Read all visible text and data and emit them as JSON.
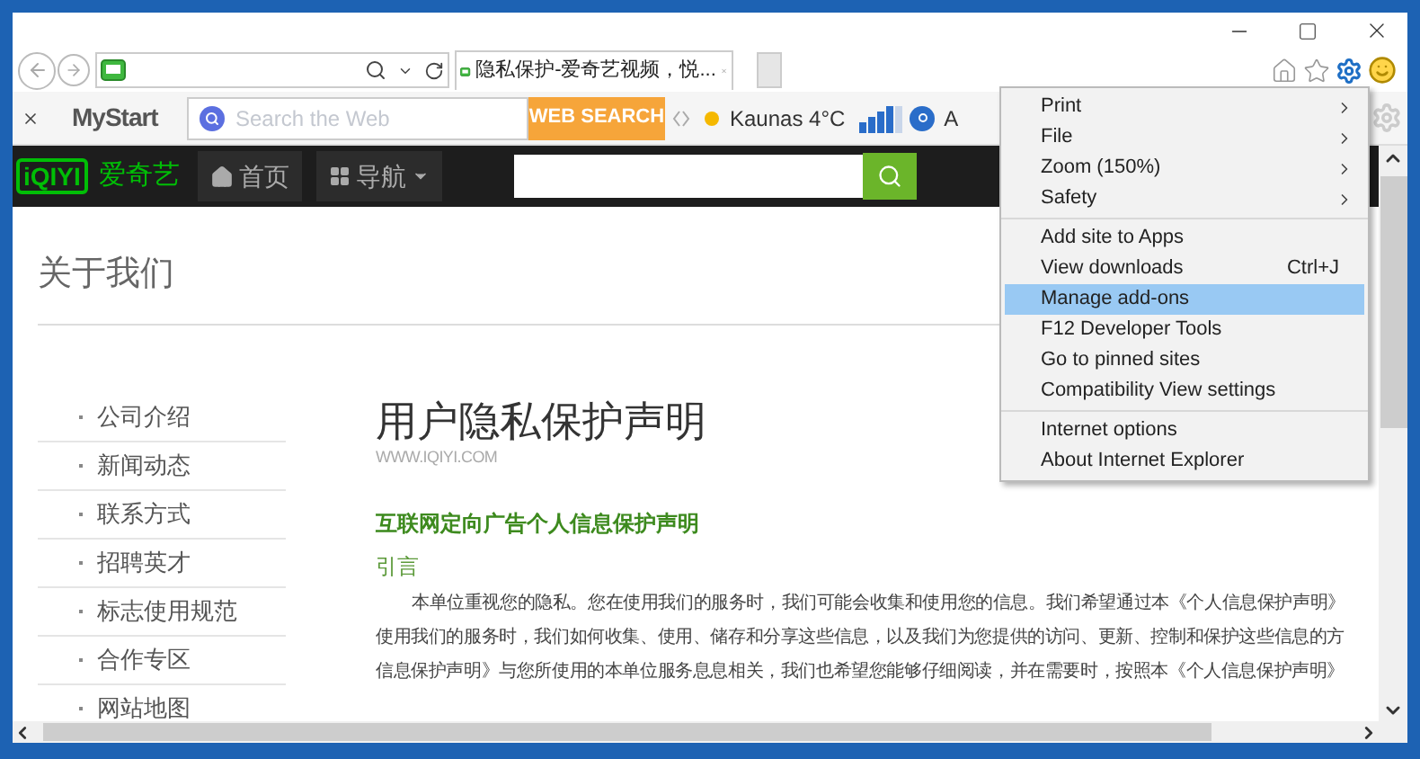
{
  "browser": {
    "tab": {
      "title": "隐私保护-爱奇艺视频，悦...",
      "selected": true
    }
  },
  "toolbar": {
    "logo": "MyStart",
    "search_placeholder": "Search the Web",
    "search_button": "WEB SEARCH",
    "weather": "Kaunas 4°C",
    "trailing_text": "A"
  },
  "site_header": {
    "logo": "iQIYI",
    "brand": "爱奇艺",
    "nav": [
      {
        "label": "首页",
        "kind": "home"
      },
      {
        "label": "导航",
        "kind": "menu"
      }
    ]
  },
  "page": {
    "heading": "关于我们",
    "sidebar": [
      {
        "label": "公司介绍"
      },
      {
        "label": "新闻动态"
      },
      {
        "label": "联系方式"
      },
      {
        "label": "招聘英才"
      },
      {
        "label": "标志使用规范"
      },
      {
        "label": "合作专区"
      },
      {
        "label": "网站地图"
      }
    ],
    "title": "用户隐私保护声明",
    "url": "WWW.IQIYI.COM",
    "subheading": "互联网定向广告个人信息保护声明",
    "section": "引言",
    "paragraph": [
      "本单位重视您的隐私。您在使用我们的服务时，我们可能会收集和使用您的信息。我们希望通过本《个人信息保护声明》",
      "使用我们的服务时，我们如何收集、使用、储存和分享这些信息，以及我们为您提供的访问、更新、控制和保护这些信息的方",
      "信息保护声明》与您所使用的本单位服务息息相关，我们也希望您能够仔细阅读，并在需要时，按照本《个人信息保护声明》"
    ]
  },
  "menu": {
    "groups": [
      [
        {
          "label": "Print",
          "submenu": true,
          "selected": false
        },
        {
          "label": "File",
          "submenu": true,
          "selected": false
        },
        {
          "label": "Zoom (150%)",
          "submenu": true,
          "selected": false
        },
        {
          "label": "Safety",
          "submenu": true,
          "selected": false
        }
      ],
      [
        {
          "label": "Add site to Apps",
          "submenu": false,
          "selected": false
        },
        {
          "label": "View downloads",
          "shortcut": "Ctrl+J",
          "submenu": false,
          "selected": false
        },
        {
          "label": "Manage add-ons",
          "submenu": false,
          "selected": true
        },
        {
          "label": "F12 Developer Tools",
          "submenu": false,
          "selected": false
        },
        {
          "label": "Go to pinned sites",
          "submenu": false,
          "selected": false
        },
        {
          "label": "Compatibility View settings",
          "submenu": false,
          "selected": false
        }
      ],
      [
        {
          "label": "Internet options",
          "submenu": false,
          "selected": false
        },
        {
          "label": "About Internet Explorer",
          "submenu": false,
          "selected": false
        }
      ]
    ]
  }
}
